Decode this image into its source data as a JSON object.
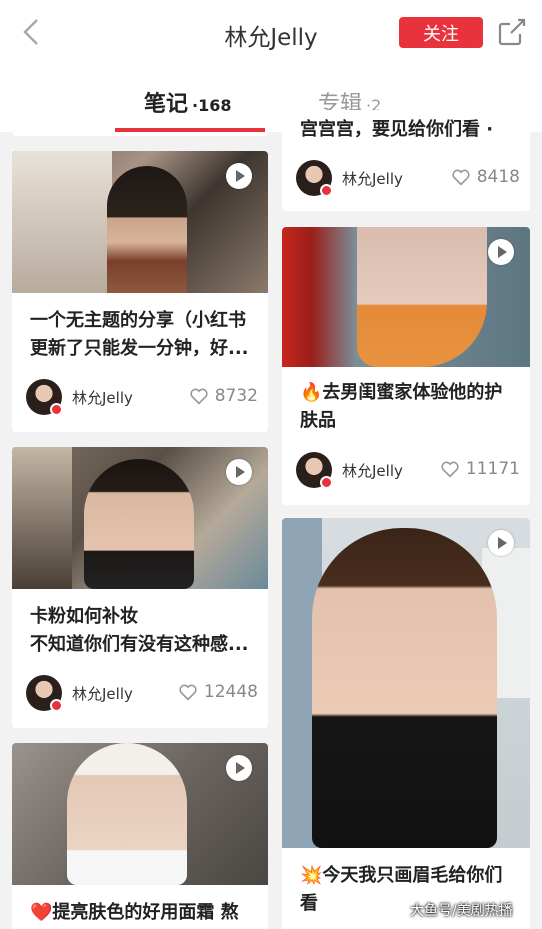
{
  "header": {
    "title": "林允Jelly",
    "follow_label": "关注"
  },
  "tabs": [
    {
      "label": "笔记",
      "count": "·168"
    },
    {
      "label": "专辑",
      "count": "·2"
    }
  ],
  "top_partial_title": "宫宫宫，要见给你们看 ·",
  "notes": [
    {
      "title": "一个无主题的分享（小红书\n更新了只能发一分钟，好...",
      "author": "林允Jelly",
      "likes": "8732"
    },
    {
      "title": "卡粉如何补妆\n不知道你们有没有这种感...",
      "author": "林允Jelly",
      "likes": "12448"
    },
    {
      "title": "❤️提亮肤色的好用面霜 熬",
      "author": "",
      "likes": ""
    },
    {
      "title": "",
      "author": "林允Jelly",
      "likes": "8418"
    },
    {
      "title": "🔥去男闺蜜家体验他的护\n肤品",
      "author": "林允Jelly",
      "likes": "11171"
    },
    {
      "title": "💥今天我只画眉毛给你们\n看",
      "author": "",
      "likes": ""
    }
  ],
  "watermark": "大鱼号/美剧热播",
  "colors": {
    "accent": "#e8323c",
    "background": "#f2f2f2"
  }
}
